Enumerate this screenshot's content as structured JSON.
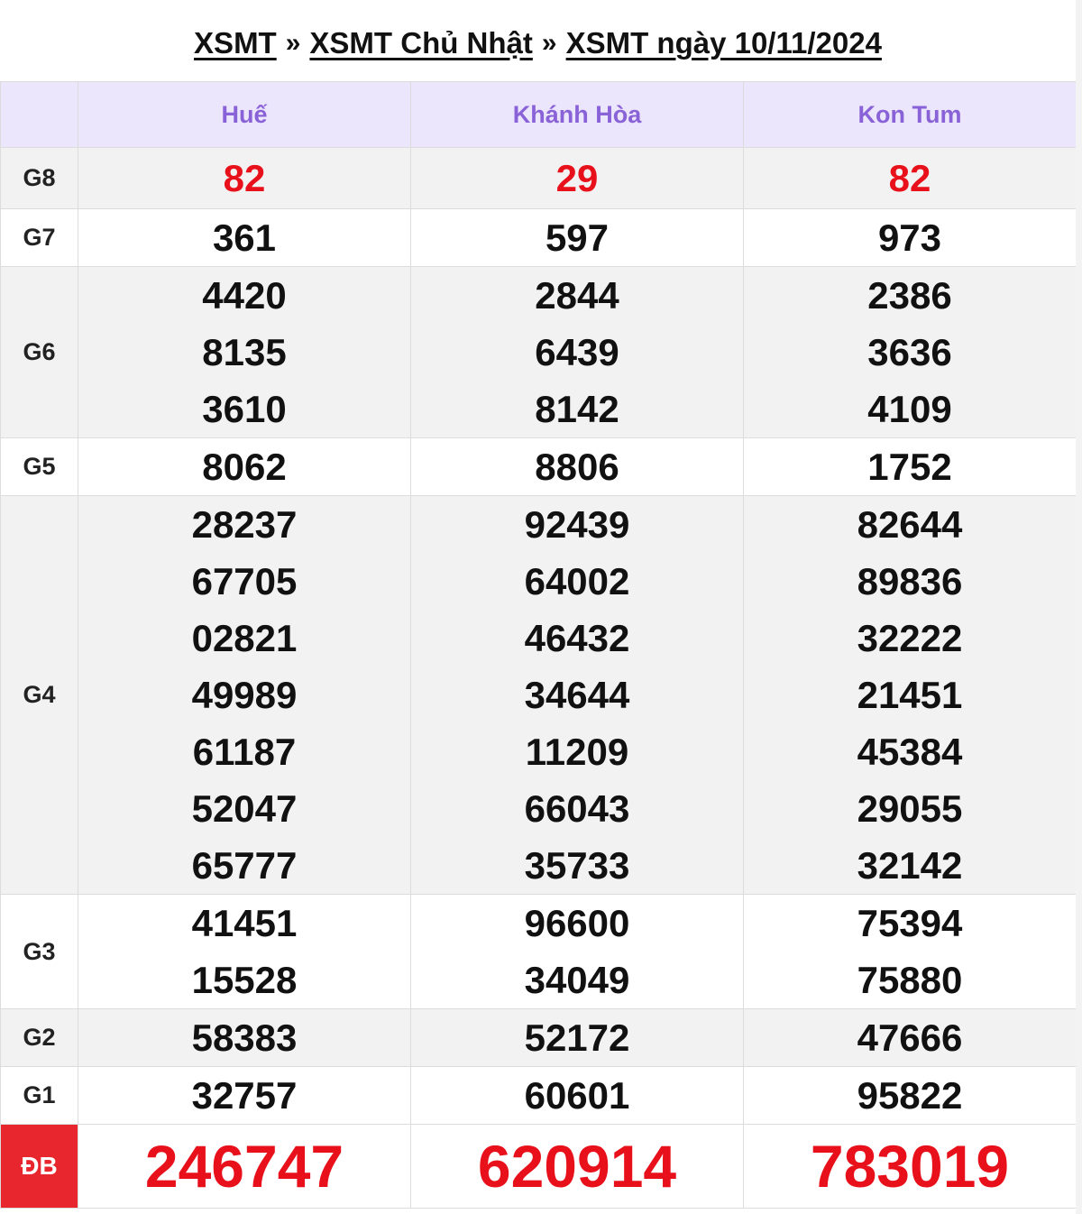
{
  "breadcrumb": {
    "items": [
      "XSMT",
      "XSMT Chủ Nhật",
      "XSMT ngày 10/11/2024"
    ],
    "separator": "»"
  },
  "provinces": [
    "Huế",
    "Khánh Hòa",
    "Kon Tum"
  ],
  "prizes": {
    "g8": {
      "label": "G8",
      "values": [
        [
          "82"
        ],
        [
          "29"
        ],
        [
          "82"
        ]
      ]
    },
    "g7": {
      "label": "G7",
      "values": [
        [
          "361"
        ],
        [
          "597"
        ],
        [
          "973"
        ]
      ]
    },
    "g6": {
      "label": "G6",
      "values": [
        [
          "4420",
          "8135",
          "3610"
        ],
        [
          "2844",
          "6439",
          "8142"
        ],
        [
          "2386",
          "3636",
          "4109"
        ]
      ]
    },
    "g5": {
      "label": "G5",
      "values": [
        [
          "8062"
        ],
        [
          "8806"
        ],
        [
          "1752"
        ]
      ]
    },
    "g4": {
      "label": "G4",
      "values": [
        [
          "28237",
          "67705",
          "02821",
          "49989",
          "61187",
          "52047",
          "65777"
        ],
        [
          "92439",
          "64002",
          "46432",
          "34644",
          "11209",
          "66043",
          "35733"
        ],
        [
          "82644",
          "89836",
          "32222",
          "21451",
          "45384",
          "29055",
          "32142"
        ]
      ]
    },
    "g3": {
      "label": "G3",
      "values": [
        [
          "41451",
          "15528"
        ],
        [
          "96600",
          "34049"
        ],
        [
          "75394",
          "75880"
        ]
      ]
    },
    "g2": {
      "label": "G2",
      "values": [
        [
          "58383"
        ],
        [
          "52172"
        ],
        [
          "47666"
        ]
      ]
    },
    "g1": {
      "label": "G1",
      "values": [
        [
          "32757"
        ],
        [
          "60601"
        ],
        [
          "95822"
        ]
      ]
    },
    "db": {
      "label": "ĐB",
      "values": [
        [
          "246747"
        ],
        [
          "620914"
        ],
        [
          "783019"
        ]
      ]
    }
  },
  "colors": {
    "header_bg": "#ebe6fb",
    "header_text": "#8a62d8",
    "highlight_red": "#e8101a",
    "db_label_bg": "#e8262d",
    "alt_row_bg": "#f2f2f2"
  }
}
